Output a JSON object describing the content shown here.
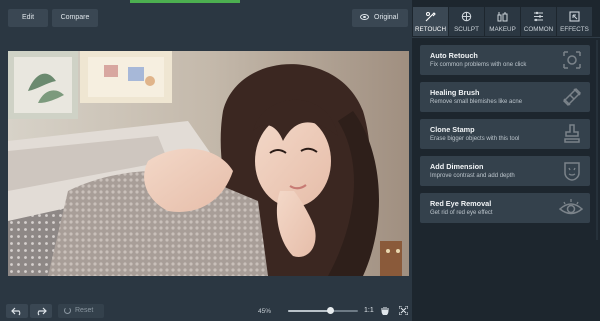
{
  "toolbar": {
    "edit_label": "Edit",
    "compare_label": "Compare",
    "original_label": "Original"
  },
  "bottom": {
    "reset_label": "Reset",
    "zoom_label": "45%",
    "zoom_value": 0.6,
    "ratio_label": "1:1"
  },
  "tabs": [
    {
      "label": "RETOUCH",
      "icon": "retouch-icon",
      "active": true
    },
    {
      "label": "SCULPT",
      "icon": "sculpt-icon",
      "active": false
    },
    {
      "label": "MAKEUP",
      "icon": "makeup-icon",
      "active": false
    },
    {
      "label": "COMMON",
      "icon": "sliders-icon",
      "active": false
    },
    {
      "label": "EFFECTS",
      "icon": "effects-icon",
      "active": false
    }
  ],
  "tools": [
    {
      "title": "Auto Retouch",
      "desc": "Fix common problems with one click",
      "icon": "auto-retouch-icon"
    },
    {
      "title": "Healing Brush",
      "desc": "Remove small blemishes like acne",
      "icon": "healing-brush-icon"
    },
    {
      "title": "Clone Stamp",
      "desc": "Erase bigger objects with this tool",
      "icon": "clone-stamp-icon"
    },
    {
      "title": "Add Dimension",
      "desc": "Improve contrast and add depth",
      "icon": "add-dimension-icon"
    },
    {
      "title": "Red Eye Removal",
      "desc": "Get rid of red eye effect",
      "icon": "red-eye-icon"
    }
  ],
  "colors": {
    "accent": "#4caf50",
    "panel": "#1d262e",
    "card": "#34414c"
  }
}
